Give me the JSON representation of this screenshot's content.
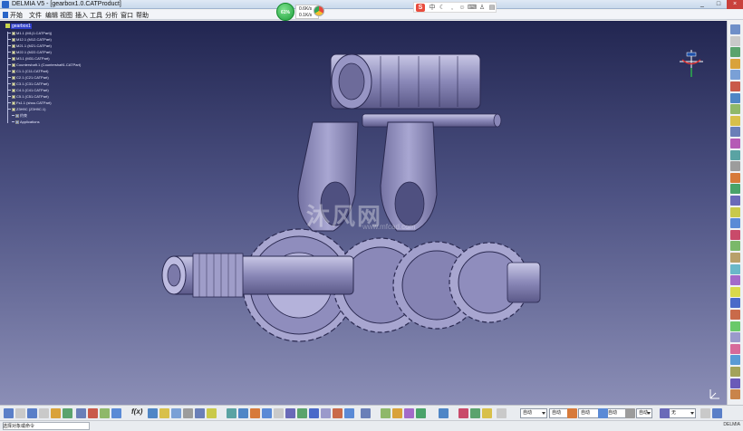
{
  "window": {
    "title": "DELMIA V5 - [gearbox1.0.CATProduct]",
    "controls": [
      "_",
      "□",
      "×"
    ]
  },
  "menu": {
    "items": [
      "开始",
      "文件",
      "编辑",
      "视图",
      "插入",
      "工具",
      "分析",
      "窗口",
      "帮助"
    ]
  },
  "overlay": {
    "speed_percent": "61%",
    "upload": "0.6K/s",
    "download": "0.1K/s",
    "tray_brand": "S"
  },
  "tree": {
    "root": "gearbox1",
    "nodes": [
      {
        "label": "M1.1 (M1(1.CATPart))",
        "sub": false
      },
      {
        "label": "M12.1 (M12.CATPart)",
        "sub": false
      },
      {
        "label": "M21.1 (M21.CATPart)",
        "sub": false
      },
      {
        "label": "M22.1 (M22.CATPart)",
        "sub": false
      },
      {
        "label": "M3.1 (M31.CATPart)",
        "sub": false
      },
      {
        "label": "Countershaft.1 (Countershaft1.CATPart)",
        "sub": false
      },
      {
        "label": "C1.1 (C11.CATPart)",
        "sub": false
      },
      {
        "label": "C2.1 (C21.CATPart)",
        "sub": false
      },
      {
        "label": "C3.1 (C31.CATPart)",
        "sub": false
      },
      {
        "label": "C4.1 (C41.CATPart)",
        "sub": false
      },
      {
        "label": "C5.1 (C51.CATPart)",
        "sub": false
      },
      {
        "label": "Fs1.1 (shou.CATPart)",
        "sub": false
      },
      {
        "label": "Z3H9C (Z3H9C.1)",
        "sub": false
      },
      {
        "label": "约束",
        "sub": true
      },
      {
        "label": "Applications",
        "sub": true
      }
    ]
  },
  "watermark": {
    "text": "沐风网",
    "sub": "www.mfcad.com"
  },
  "bottom_toolbar": {
    "fo_label": "f(x)",
    "selects": [
      {
        "value": "自动"
      },
      {
        "value": "自动"
      },
      {
        "value": "自动"
      },
      {
        "value": "自动"
      },
      {
        "value": "自动"
      },
      {
        "value": "无"
      }
    ]
  },
  "status": {
    "message": "选择对象或命令",
    "logo": "DELMIA"
  }
}
